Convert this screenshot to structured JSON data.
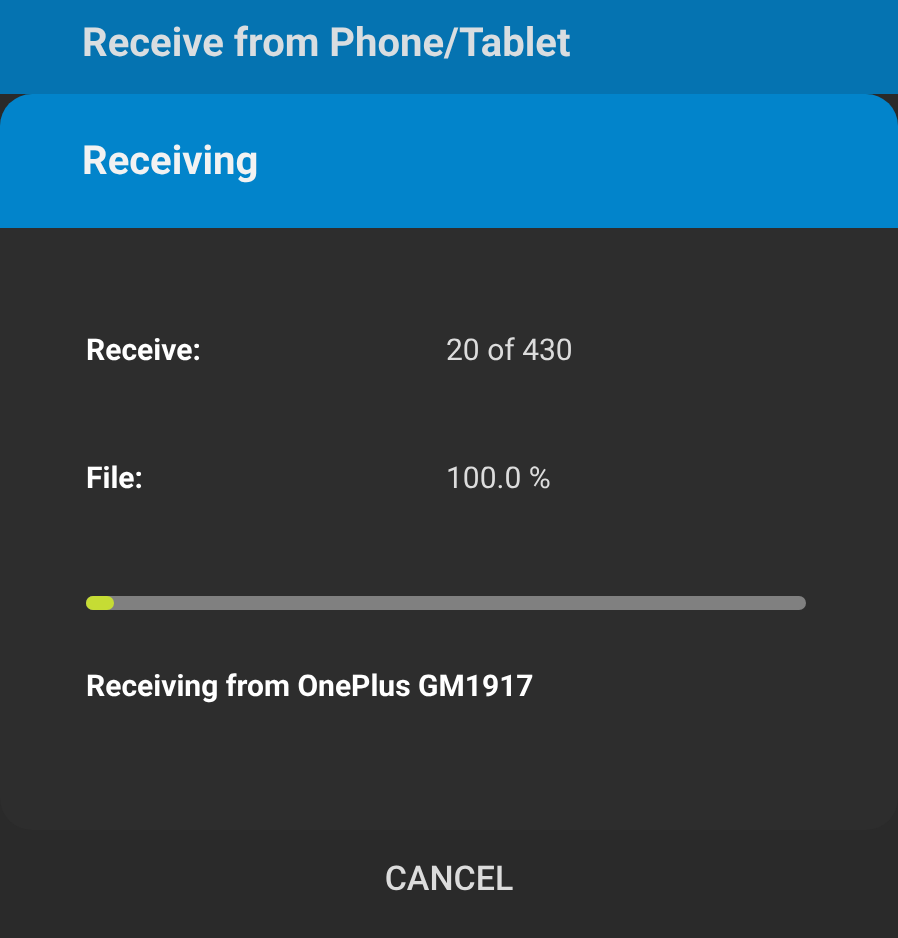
{
  "app_bar": {
    "title": "Receive from Phone/Tablet"
  },
  "dialog": {
    "title": "Receiving",
    "rows": [
      {
        "label": "Receive:",
        "value": "20 of 430"
      },
      {
        "label": "File:",
        "value": "100.0 %"
      }
    ],
    "progress": {
      "level": 0.04
    },
    "status": "Receiving from OnePlus GM1917"
  },
  "buttons": [
    {
      "label": "CANCEL"
    }
  ]
}
